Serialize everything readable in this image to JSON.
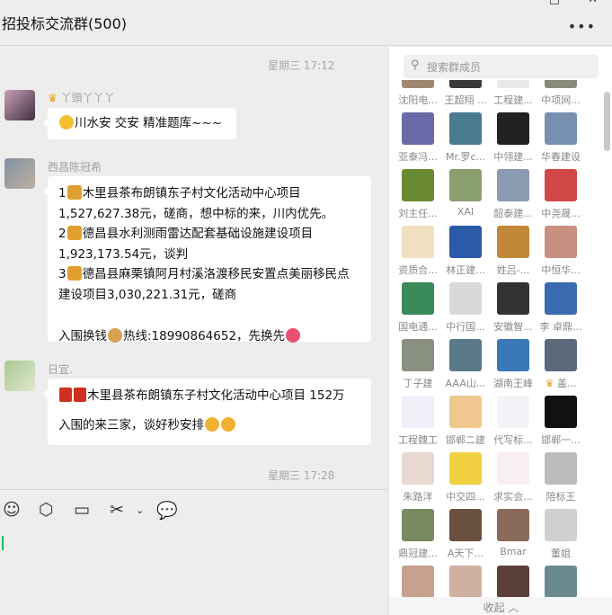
{
  "window": {
    "title": "招投标交流群(500)",
    "more_label": "•••",
    "maximize_icon": "□",
    "close_icon": "✕"
  },
  "chat": {
    "timestamps": [
      "星期三 17:12",
      "星期三 17:28"
    ],
    "messages": [
      {
        "sender": "丫頭丫丫丫",
        "lines": [
          "川水安 交安 精准题库~~~"
        ]
      },
      {
        "sender": "西昌陈冠希",
        "lines": [
          "1",
          "木里县茶布朗镇东子村文化活动中心项目",
          "1,527,627.38元，磋商，想中标的来，川内优先。",
          "2",
          "德昌县水利测雨雷达配套基础设施建设项目",
          "1,923,173.54元，谈判",
          "3",
          "德昌县麻栗镇阿月村溪洛渡移民安置点美丽移民点",
          "建设项目3,030,221.31元，磋商",
          "入围换钱",
          "热线:18990864652，先换先"
        ]
      },
      {
        "sender": "日宜.",
        "lines": [
          "木里县茶布朗镇东子村文化活动中心项目 152万",
          "入围的来三家，谈好秒安排"
        ]
      }
    ]
  },
  "toolbar": [
    "emoji-icon",
    "sticker-box-icon",
    "folder-icon",
    "scissors-icon",
    "chat-bubble-icon"
  ],
  "members": {
    "search_placeholder": "搜索群成员",
    "names": [
      "沈阳电...",
      "王超翔 ...",
      "工程建...",
      "中项网...",
      "亚泰冯...",
      "Mr.罗c...",
      "中翎建...",
      "华春建设",
      "刘主任...",
      "XAI",
      "韶泰建...",
      "中尧晟...",
      "资质合...",
      "林正建...",
      "姓吕-...",
      "中恒华...",
      "国电通...",
      "中行国...",
      "安徽智...",
      "李 卓鼎...",
      "丁子建",
      "AAA山...",
      "湖南王峰",
      "盖...",
      "工程魏工",
      "邯郸二建",
      "代写标...",
      "邯郸一...",
      "朱路洋",
      "中交四...",
      "求实会...",
      "陪标王",
      "鼎冠建...",
      "A天下...",
      "Bmar",
      "董姐"
    ],
    "colors": [
      "#a08870",
      "#3a3a3a",
      "#e8e8e8",
      "#8a8a7a",
      "#6a6aa8",
      "#4a7a90",
      "#222222",
      "#7890b0",
      "#6a8a30",
      "#8aa070",
      "#8a9ab0",
      "#d04848",
      "#f0e0c0",
      "#2a5aa8",
      "#c08838",
      "#c89080",
      "#3a8a5a",
      "#d8d8d8",
      "#333333",
      "#3a6ab0",
      "#8a9080",
      "#5a7a8a",
      "#3a78b8",
      "#5a6a7a",
      "#f0f0f8",
      "#f0c890",
      "#f4f4f8",
      "#111111",
      "#e8d8d0",
      "#f0d040",
      "#f8f0f0",
      "#bbbbbb",
      "#7a8a60",
      "#6a5040",
      "#8a6a5a",
      "#d0d0d0",
      "#c8a090",
      "#d0b0a0",
      "#5a4038",
      "#6a8a90"
    ],
    "collapse_label": "收起 ︿"
  }
}
